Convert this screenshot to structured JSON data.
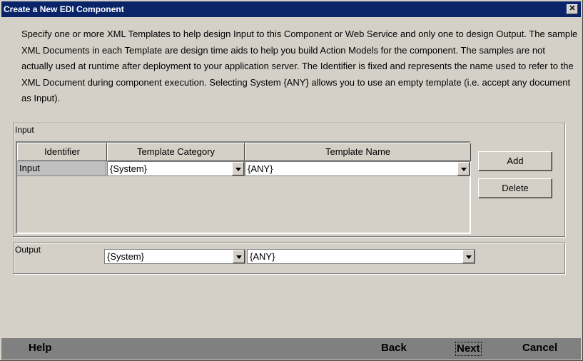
{
  "window": {
    "title": "Create a New EDI Component",
    "close_icon": "close-icon"
  },
  "description": "Specify one or more XML Templates to help design Input to this Component or Web Service and only one to design Output.  The sample XML Documents in each Template are design time aids to help you build Action Models for the component.  The samples are not actually used at runtime after deployment to your application server.  The Identifier is fixed and represents the name used to refer to the XML Document during component execution.  Selecting System {ANY} allows you to use an empty template (i.e. accept any document as Input).",
  "input": {
    "label": "Input",
    "columns": [
      "Identifier",
      "Template Category",
      "Template Name"
    ],
    "rows": [
      {
        "identifier": "Input",
        "category": "{System}",
        "name": "{ANY}"
      }
    ],
    "add_label": "Add",
    "delete_label": "Delete"
  },
  "output": {
    "label": "Output",
    "category": "{System}",
    "name": "{ANY}"
  },
  "footer": {
    "help": "Help",
    "back": "Back",
    "next": "Next",
    "cancel": "Cancel"
  }
}
